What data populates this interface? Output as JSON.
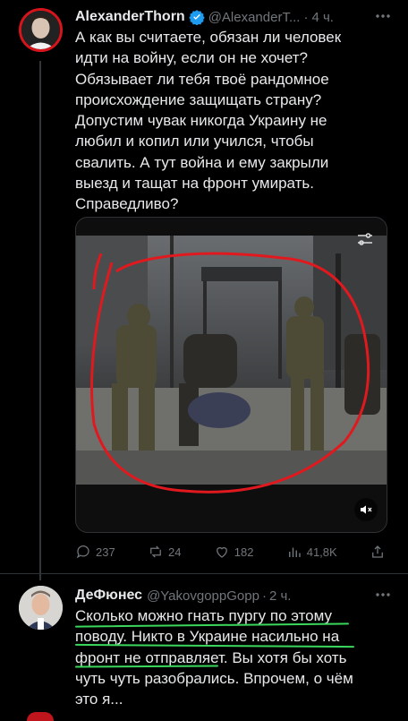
{
  "tweet1": {
    "author_name": "AlexanderThorn",
    "handle": "@AlexanderT...",
    "time": "4 ч.",
    "separator": "·",
    "lines": [
      "А как вы считаете, обязан ли человек",
      "идти на войну, если он не хочет?",
      "Обязывает ли тебя твоё рандомное",
      "происхождение защищать страну?",
      "Допустим чувак никогда Украину не",
      "любил и копил или учился, чтобы",
      "свалить. А тут война и ему закрыли",
      "выезд и тащат на фронт умирать.",
      "Справедливо?"
    ],
    "actions": {
      "replies": "237",
      "reposts": "24",
      "likes": "182",
      "views": "41,8K"
    }
  },
  "tweet2": {
    "author_name": "ДеФюнес",
    "handle": "@YakovgoppGopp",
    "time": "2 ч.",
    "separator": "·",
    "lines": [
      "Сколько можно гнать пургу по этому",
      "поводу. Никто в Украине насильно на",
      "фронт не отправляет. Вы хотя бы хоть",
      "чуть чуть разобрались. Впрочем, о чём",
      "это я..."
    ]
  },
  "icons": {
    "verified": "verified-badge-icon",
    "more": "more-icon",
    "reply": "reply-icon",
    "repost": "repost-icon",
    "like": "like-icon",
    "views": "views-icon",
    "share": "share-icon",
    "mute": "volume-muted-icon",
    "video_settings": "video-settings-icon"
  },
  "colors": {
    "background": "#000000",
    "text": "#e7e9ea",
    "secondary": "#71767b",
    "verified": "#1d9bf0",
    "annotation_red": "#e0191f",
    "annotation_green": "#3bd65c"
  }
}
